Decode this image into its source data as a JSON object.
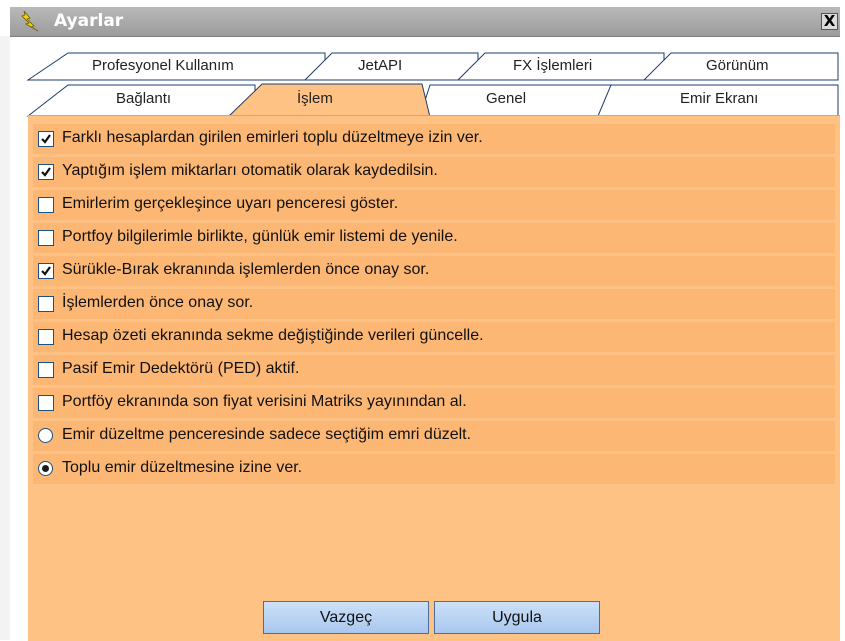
{
  "window": {
    "title": "Ayarlar",
    "close_label": "X"
  },
  "tabs_top": [
    {
      "label": "Profesyonel Kullanım"
    },
    {
      "label": "JetAPI"
    },
    {
      "label": "FX İşlemleri"
    },
    {
      "label": "Görünüm"
    }
  ],
  "tabs_bottom": [
    {
      "label": "Bağlantı"
    },
    {
      "label": "İşlem",
      "active": true
    },
    {
      "label": "Genel"
    },
    {
      "label": "Emir Ekranı"
    }
  ],
  "options": [
    {
      "type": "checkbox",
      "checked": true,
      "label": "Farklı hesaplardan girilen emirleri toplu düzeltmeye izin ver."
    },
    {
      "type": "checkbox",
      "checked": true,
      "label": "Yaptığım işlem miktarları otomatik olarak kaydedilsin."
    },
    {
      "type": "checkbox",
      "checked": false,
      "label": "Emirlerim gerçekleşince uyarı penceresi göster."
    },
    {
      "type": "checkbox",
      "checked": false,
      "label": "Portfoy bilgilerimle birlikte, günlük emir listemi de yenile."
    },
    {
      "type": "checkbox",
      "checked": true,
      "label": "Sürükle-Bırak ekranında işlemlerden önce onay sor."
    },
    {
      "type": "checkbox",
      "checked": false,
      "label": "İşlemlerden önce onay sor."
    },
    {
      "type": "checkbox",
      "checked": false,
      "label": "Hesap özeti ekranında sekme değiştiğinde verileri güncelle."
    },
    {
      "type": "checkbox",
      "checked": false,
      "label": "Pasif Emir Dedektörü (PED) aktif."
    },
    {
      "type": "checkbox",
      "checked": false,
      "label": "Portföy ekranında son fiyat verisini Matriks yayınından al."
    },
    {
      "type": "radio",
      "checked": false,
      "label": "Emir düzeltme penceresinde sadece seçtiğim emri düzelt."
    },
    {
      "type": "radio",
      "checked": true,
      "label": "Toplu emir düzeltmesine izine ver."
    }
  ],
  "buttons": {
    "cancel_label": "Vazgeç",
    "apply_label": "Uygula"
  },
  "colors": {
    "panel": "#ffc285",
    "active_tab": "#ffc285",
    "inactive_tab": "#ffffff",
    "accent_border": "#1c5180"
  }
}
